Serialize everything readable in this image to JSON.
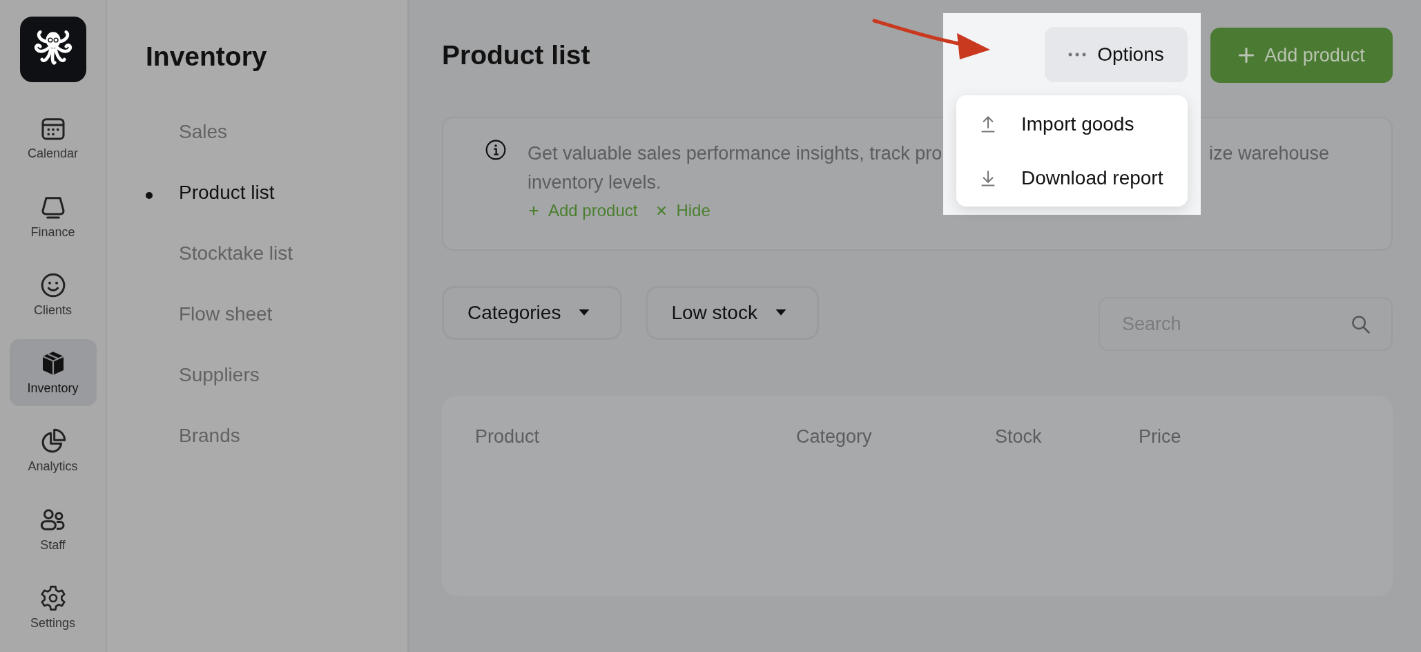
{
  "app_rail": {
    "items": [
      {
        "label": "Calendar",
        "kind": "calendar",
        "selected": false
      },
      {
        "label": "Finance",
        "kind": "finance",
        "selected": false
      },
      {
        "label": "Clients",
        "kind": "clients",
        "selected": false
      },
      {
        "label": "Inventory",
        "kind": "inventory",
        "selected": true
      },
      {
        "label": "Analytics",
        "kind": "analytics",
        "selected": false
      },
      {
        "label": "Staff",
        "kind": "staff",
        "selected": false
      },
      {
        "label": "Settings",
        "kind": "settings",
        "selected": false
      }
    ]
  },
  "section_nav": {
    "title": "Inventory",
    "items": [
      {
        "label": "Sales",
        "selected": false
      },
      {
        "label": "Product list",
        "selected": true
      },
      {
        "label": "Stocktake list",
        "selected": false
      },
      {
        "label": "Flow sheet",
        "selected": false
      },
      {
        "label": "Suppliers",
        "selected": false
      },
      {
        "label": "Brands",
        "selected": false
      }
    ]
  },
  "page": {
    "title": "Product list"
  },
  "options": {
    "label": "Options",
    "menu": [
      {
        "label": "Import goods",
        "kind": "import"
      },
      {
        "label": "Download report",
        "kind": "download"
      }
    ]
  },
  "primary_button": {
    "label": "Add product"
  },
  "info_banner": {
    "text_before": "Get valuable sales performance insights, track pro",
    "text_after": "ize warehouse",
    "text_line_2": "inventory levels.",
    "actions": [
      {
        "label": "Add product",
        "kind": "add"
      },
      {
        "label": "Hide",
        "kind": "hide"
      }
    ]
  },
  "filters": [
    {
      "label": "Categories"
    },
    {
      "label": "Low stock"
    }
  ],
  "search": {
    "placeholder": "Search"
  },
  "table": {
    "columns": [
      "Product",
      "Category",
      "Stock",
      "Price"
    ]
  }
}
